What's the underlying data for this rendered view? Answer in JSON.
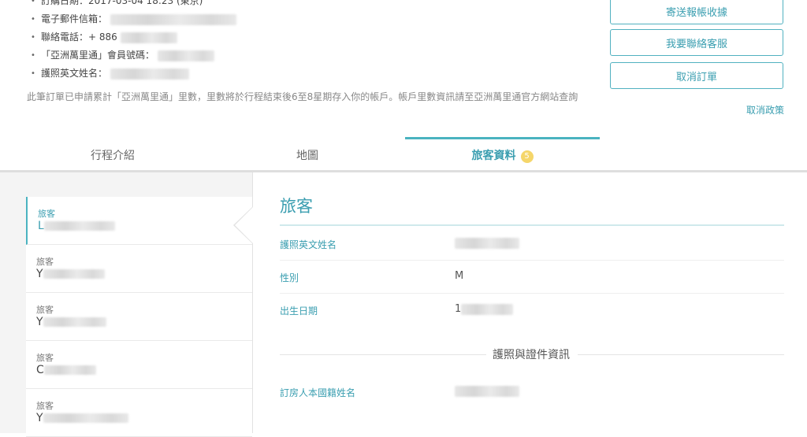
{
  "info": {
    "order_date": "訂購日期：2017-03-04 18:23 (東京)",
    "email_label": "電子郵件信箱：",
    "phone_label": "聯絡電話：+ 886",
    "member_label": "「亞洲萬里通」會員號碼：",
    "passport_label": "護照英文姓名："
  },
  "note": "此筆訂單已申請累計「亞洲萬里通」里數，里數將於行程結束後6至8星期存入你的帳戶。帳戶里數資訊請至亞洲萬里通官方網站查詢",
  "actions": {
    "send_receipt": "寄送報帳收據",
    "contact_service": "我要聯絡客服",
    "cancel_order": "取消訂單",
    "cancel_policy": "取消政策"
  },
  "tabs": [
    {
      "label": "行程介紹"
    },
    {
      "label": "地圖"
    },
    {
      "label": "旅客資料",
      "badge": "5"
    }
  ],
  "travelers": [
    {
      "label": "旅客",
      "name": "L"
    },
    {
      "label": "旅客",
      "name": "Y"
    },
    {
      "label": "旅客",
      "name": "Y"
    },
    {
      "label": "旅客",
      "name": "C"
    },
    {
      "label": "旅客",
      "name": "Y"
    }
  ],
  "detail": {
    "title": "旅客",
    "fields": [
      {
        "label": "護照英文姓名",
        "value": ""
      },
      {
        "label": "性別",
        "value": "M"
      },
      {
        "label": "出生日期",
        "value": "1"
      }
    ],
    "section_title": "護照與證件資訊",
    "section_fields": [
      {
        "label": "訂房人本國籍姓名",
        "value": ""
      }
    ]
  },
  "colors": {
    "accent": "#3a9eb0",
    "badge": "#f5d66a",
    "list_bg": "#f4f4f4"
  }
}
